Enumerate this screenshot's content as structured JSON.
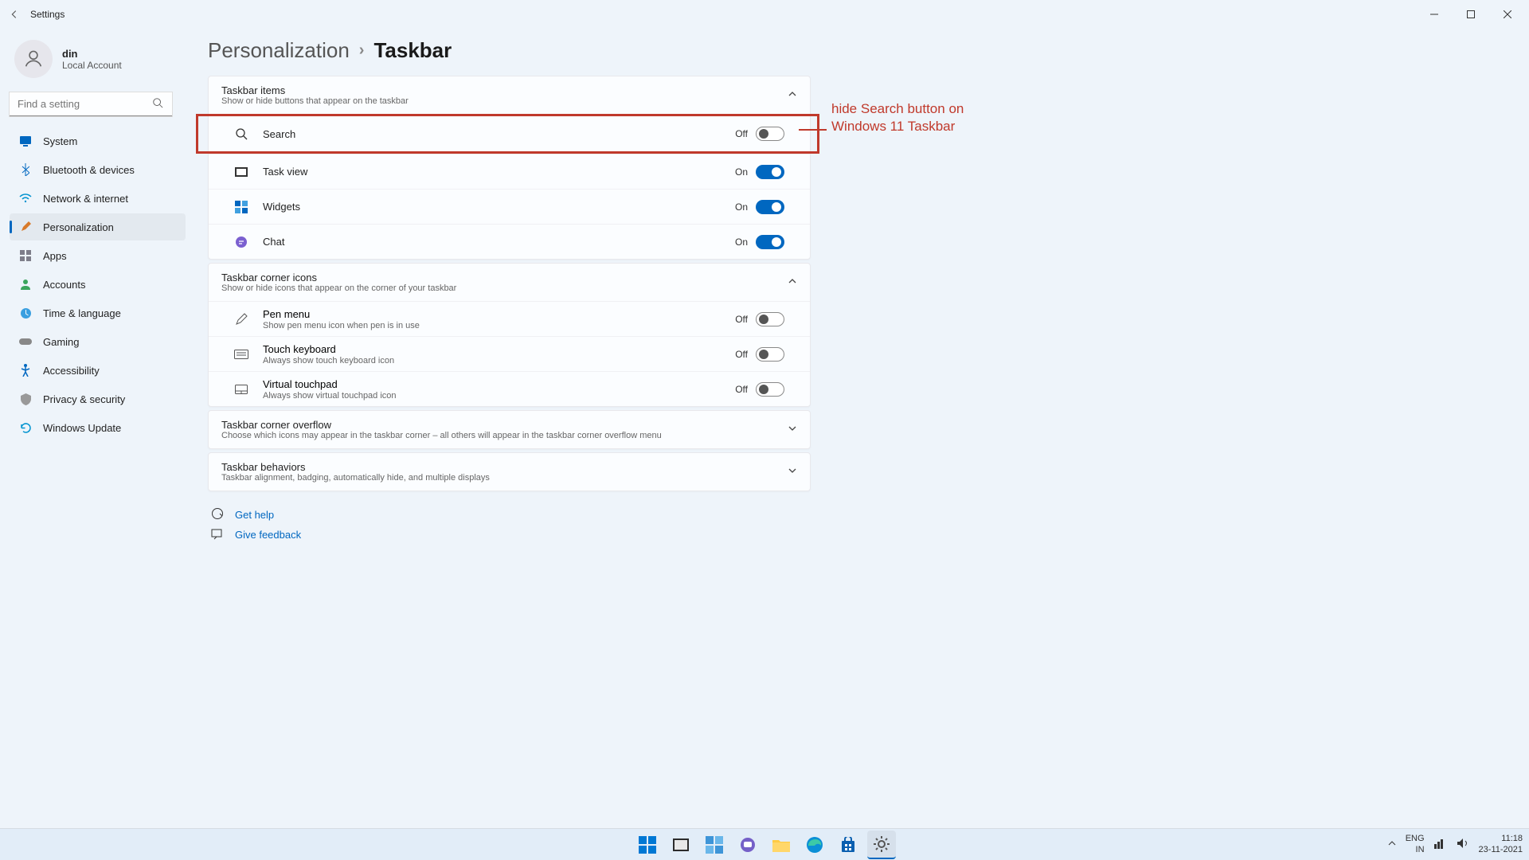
{
  "window": {
    "title": "Settings"
  },
  "profile": {
    "name": "din",
    "sub": "Local Account"
  },
  "search": {
    "placeholder": "Find a setting"
  },
  "nav": [
    {
      "label": "System"
    },
    {
      "label": "Bluetooth & devices"
    },
    {
      "label": "Network & internet"
    },
    {
      "label": "Personalization"
    },
    {
      "label": "Apps"
    },
    {
      "label": "Accounts"
    },
    {
      "label": "Time & language"
    },
    {
      "label": "Gaming"
    },
    {
      "label": "Accessibility"
    },
    {
      "label": "Privacy & security"
    },
    {
      "label": "Windows Update"
    }
  ],
  "breadcrumb": {
    "parent": "Personalization",
    "current": "Taskbar"
  },
  "sections": {
    "items": {
      "title": "Taskbar items",
      "desc": "Show or hide buttons that appear on the taskbar",
      "rows": [
        {
          "label": "Search",
          "state": "Off",
          "on": false
        },
        {
          "label": "Task view",
          "state": "On",
          "on": true
        },
        {
          "label": "Widgets",
          "state": "On",
          "on": true
        },
        {
          "label": "Chat",
          "state": "On",
          "on": true
        }
      ]
    },
    "corner": {
      "title": "Taskbar corner icons",
      "desc": "Show or hide icons that appear on the corner of your taskbar",
      "rows": [
        {
          "label": "Pen menu",
          "sub": "Show pen menu icon when pen is in use",
          "state": "Off"
        },
        {
          "label": "Touch keyboard",
          "sub": "Always show touch keyboard icon",
          "state": "Off"
        },
        {
          "label": "Virtual touchpad",
          "sub": "Always show virtual touchpad icon",
          "state": "Off"
        }
      ]
    },
    "overflow": {
      "title": "Taskbar corner overflow",
      "desc": "Choose which icons may appear in the taskbar corner – all others will appear in the taskbar corner overflow menu"
    },
    "behaviors": {
      "title": "Taskbar behaviors",
      "desc": "Taskbar alignment, badging, automatically hide, and multiple displays"
    }
  },
  "callout": {
    "line1": "hide Search button on",
    "line2": "Windows 11 Taskbar"
  },
  "links": {
    "help": "Get help",
    "feedback": "Give feedback"
  },
  "tray": {
    "lang1": "ENG",
    "lang2": "IN",
    "time": "11:18",
    "date": "23-11-2021"
  }
}
